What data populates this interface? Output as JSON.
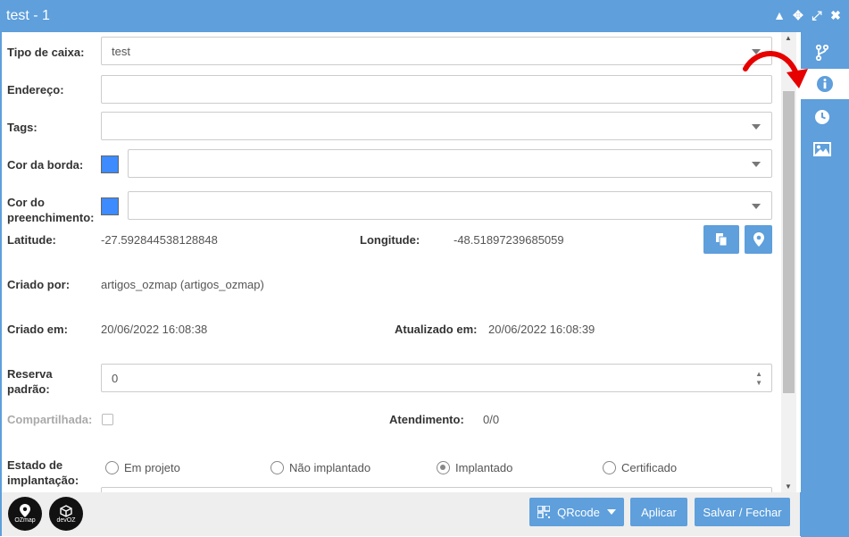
{
  "window": {
    "title": "test - 1"
  },
  "form": {
    "tipo_caixa": {
      "label": "Tipo de caixa:",
      "value": "test"
    },
    "endereco": {
      "label": "Endereço:",
      "value": ""
    },
    "tags": {
      "label": "Tags:",
      "value": ""
    },
    "cor_borda": {
      "label": "Cor da borda:",
      "color": "#3d8bff",
      "value": ""
    },
    "cor_preenchimento": {
      "label_line1": "Cor do",
      "label_line2": "preenchimento:",
      "color": "#3d8bff",
      "value": ""
    },
    "latitude": {
      "label": "Latitude:",
      "value": "-27.592844538128848"
    },
    "longitude": {
      "label": "Longitude:",
      "value": "-48.51897239685059"
    },
    "criado_por": {
      "label": "Criado por:",
      "value": "artigos_ozmap (artigos_ozmap)"
    },
    "criado_em": {
      "label": "Criado em:",
      "value": "20/06/2022 16:08:38"
    },
    "atualizado_em": {
      "label": "Atualizado em:",
      "value": "20/06/2022 16:08:39"
    },
    "reserva_padrao": {
      "label_line1": "Reserva",
      "label_line2": "padrão:",
      "value": "0"
    },
    "compartilhada": {
      "label": "Compartilhada:"
    },
    "atendimento": {
      "label": "Atendimento:",
      "value": "0/0"
    },
    "estado_implantacao": {
      "label_line1": "Estado de",
      "label_line2": "implantação:",
      "options": [
        "Em projeto",
        "Não implantado",
        "Implantado",
        "Certificado"
      ],
      "selected": "Implantado"
    }
  },
  "footer": {
    "logo1": "OZmap",
    "logo2": "devOZ",
    "qrcode_label": "QRcode",
    "apply_label": "Aplicar",
    "save_close_label": "Salvar / Fechar"
  },
  "colors": {
    "accent": "#5e9fdc",
    "swatch": "#3d8bff",
    "arrow": "#e60000"
  },
  "icons": [
    "branch-icon",
    "info-icon",
    "clock-icon",
    "image-icon",
    "copy-icon",
    "map-pin-icon",
    "qrcode-icon"
  ]
}
